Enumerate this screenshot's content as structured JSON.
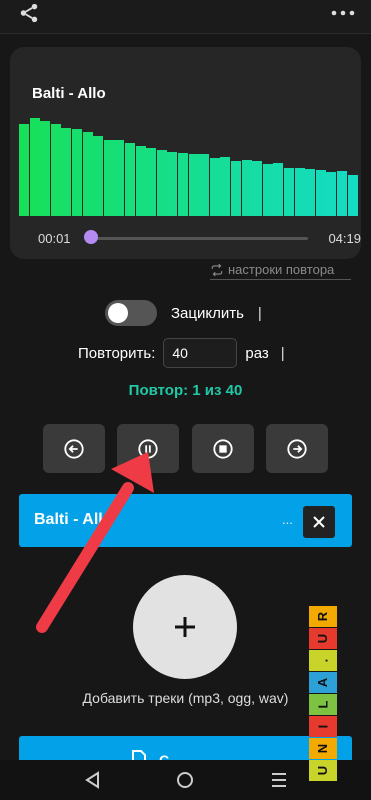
{
  "header": {
    "share_icon": "share-icon",
    "more_icon": "more-vert-icon"
  },
  "player": {
    "track_title": "Balti - Allo",
    "time_current": "00:01",
    "time_total": "04:19",
    "progress": 0.01,
    "spectrum_levels": [
      0.84,
      0.89,
      0.86,
      0.84,
      0.8,
      0.79,
      0.76,
      0.73,
      0.69,
      0.69,
      0.66,
      0.64,
      0.62,
      0.6,
      0.58,
      0.57,
      0.56,
      0.56,
      0.53,
      0.54,
      0.5,
      0.51,
      0.5,
      0.47,
      0.48,
      0.44,
      0.44,
      0.43,
      0.42,
      0.4,
      0.41,
      0.37
    ],
    "spectrum_colors": [
      "#17e05a",
      "#14dcc4"
    ]
  },
  "repeat_settings": {
    "link_label": "настроки повтора",
    "icon": "repeat-icon"
  },
  "loop": {
    "label": "Зациклить",
    "enabled": false,
    "separator": "|"
  },
  "repeat": {
    "label": "Повторить:",
    "value": "40",
    "unit": "раз",
    "separator": "|"
  },
  "repeat_status": "Повтор: 1 из 40",
  "controls": [
    {
      "icon": "prev-icon",
      "name": "prev-button"
    },
    {
      "icon": "pause-icon",
      "name": "pause-button"
    },
    {
      "icon": "stop-icon",
      "name": "stop-button"
    },
    {
      "icon": "next-icon",
      "name": "next-button"
    }
  ],
  "playlist": {
    "current_track": "Balti - Allo",
    "ellipsis": "...",
    "remove_icon": "close-icon"
  },
  "add_tracks": {
    "icon": "plus-icon",
    "hint": "Добавить треки (mp3, ogg, wav)"
  },
  "bottom_button": {
    "label": "С",
    "icon": "document-icon"
  },
  "watermark": {
    "letters": [
      "R",
      "U",
      ".",
      "A",
      "L",
      "I",
      "N",
      "U"
    ],
    "colors": [
      "#f2a900",
      "#e63a2e",
      "#c8d42a",
      "#2ea0d8",
      "#7ec242",
      "#e63a2e",
      "#f2a900",
      "#c8d42a"
    ]
  },
  "colors": {
    "accent": "#03a2e8",
    "status": "#22c8a5",
    "seek_knob": "#b48bf0",
    "arrow": "#ee3b45"
  }
}
